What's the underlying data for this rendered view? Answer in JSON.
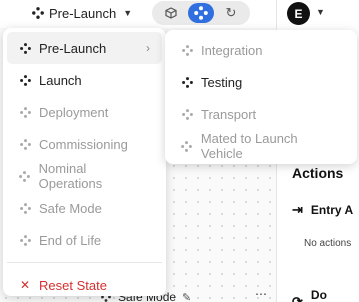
{
  "toolbar": {
    "phase_label": "Pre-Launch",
    "avatar_initial": "E"
  },
  "menu": {
    "items": [
      {
        "label": "Pre-Launch",
        "has_submenu": true,
        "state": "hover"
      },
      {
        "label": "Launch",
        "state": "enabled"
      },
      {
        "label": "Deployment",
        "state": "disabled"
      },
      {
        "label": "Commissioning",
        "state": "disabled"
      },
      {
        "label": "Nominal Operations",
        "state": "disabled"
      },
      {
        "label": "Safe Mode",
        "state": "disabled"
      },
      {
        "label": "End of Life",
        "state": "disabled"
      }
    ],
    "reset_label": "Reset State"
  },
  "submenu": {
    "items": [
      {
        "label": "Integration",
        "state": "disabled"
      },
      {
        "label": "Testing",
        "state": "enabled"
      },
      {
        "label": "Transport",
        "state": "disabled"
      },
      {
        "label": "Mated to Launch Vehicle",
        "state": "disabled"
      }
    ]
  },
  "right_panel": {
    "section_title": "Actions",
    "entry_label": "Entry A",
    "entry_note": "No actions",
    "do_label": "Do Actio"
  },
  "canvas": {
    "node_label": "Safe Mode"
  },
  "colors": {
    "accent": "#2f6fe0",
    "danger": "#d63030",
    "disabled_text": "#9a9a9a"
  }
}
